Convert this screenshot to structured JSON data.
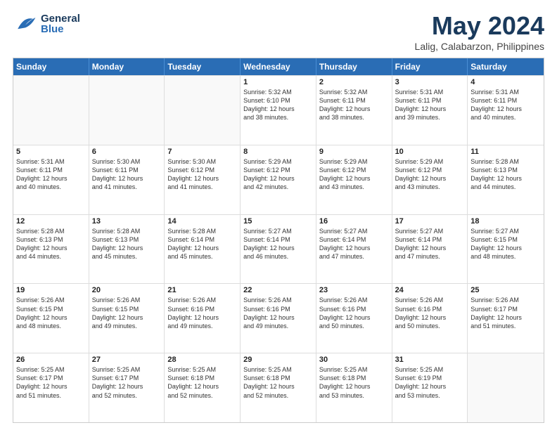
{
  "header": {
    "logo": {
      "general": "General",
      "blue": "Blue"
    },
    "title": "May 2024",
    "subtitle": "Lalig, Calabarzon, Philippines"
  },
  "calendar": {
    "days_of_week": [
      "Sunday",
      "Monday",
      "Tuesday",
      "Wednesday",
      "Thursday",
      "Friday",
      "Saturday"
    ],
    "weeks": [
      [
        {
          "day": "",
          "empty": true
        },
        {
          "day": "",
          "empty": true
        },
        {
          "day": "",
          "empty": true
        },
        {
          "day": "1",
          "lines": [
            "Sunrise: 5:32 AM",
            "Sunset: 6:10 PM",
            "Daylight: 12 hours",
            "and 38 minutes."
          ]
        },
        {
          "day": "2",
          "lines": [
            "Sunrise: 5:32 AM",
            "Sunset: 6:11 PM",
            "Daylight: 12 hours",
            "and 38 minutes."
          ]
        },
        {
          "day": "3",
          "lines": [
            "Sunrise: 5:31 AM",
            "Sunset: 6:11 PM",
            "Daylight: 12 hours",
            "and 39 minutes."
          ]
        },
        {
          "day": "4",
          "lines": [
            "Sunrise: 5:31 AM",
            "Sunset: 6:11 PM",
            "Daylight: 12 hours",
            "and 40 minutes."
          ]
        }
      ],
      [
        {
          "day": "5",
          "lines": [
            "Sunrise: 5:31 AM",
            "Sunset: 6:11 PM",
            "Daylight: 12 hours",
            "and 40 minutes."
          ]
        },
        {
          "day": "6",
          "lines": [
            "Sunrise: 5:30 AM",
            "Sunset: 6:11 PM",
            "Daylight: 12 hours",
            "and 41 minutes."
          ]
        },
        {
          "day": "7",
          "lines": [
            "Sunrise: 5:30 AM",
            "Sunset: 6:12 PM",
            "Daylight: 12 hours",
            "and 41 minutes."
          ]
        },
        {
          "day": "8",
          "lines": [
            "Sunrise: 5:29 AM",
            "Sunset: 6:12 PM",
            "Daylight: 12 hours",
            "and 42 minutes."
          ]
        },
        {
          "day": "9",
          "lines": [
            "Sunrise: 5:29 AM",
            "Sunset: 6:12 PM",
            "Daylight: 12 hours",
            "and 43 minutes."
          ]
        },
        {
          "day": "10",
          "lines": [
            "Sunrise: 5:29 AM",
            "Sunset: 6:12 PM",
            "Daylight: 12 hours",
            "and 43 minutes."
          ]
        },
        {
          "day": "11",
          "lines": [
            "Sunrise: 5:28 AM",
            "Sunset: 6:13 PM",
            "Daylight: 12 hours",
            "and 44 minutes."
          ]
        }
      ],
      [
        {
          "day": "12",
          "lines": [
            "Sunrise: 5:28 AM",
            "Sunset: 6:13 PM",
            "Daylight: 12 hours",
            "and 44 minutes."
          ]
        },
        {
          "day": "13",
          "lines": [
            "Sunrise: 5:28 AM",
            "Sunset: 6:13 PM",
            "Daylight: 12 hours",
            "and 45 minutes."
          ]
        },
        {
          "day": "14",
          "lines": [
            "Sunrise: 5:28 AM",
            "Sunset: 6:14 PM",
            "Daylight: 12 hours",
            "and 45 minutes."
          ]
        },
        {
          "day": "15",
          "lines": [
            "Sunrise: 5:27 AM",
            "Sunset: 6:14 PM",
            "Daylight: 12 hours",
            "and 46 minutes."
          ]
        },
        {
          "day": "16",
          "lines": [
            "Sunrise: 5:27 AM",
            "Sunset: 6:14 PM",
            "Daylight: 12 hours",
            "and 47 minutes."
          ]
        },
        {
          "day": "17",
          "lines": [
            "Sunrise: 5:27 AM",
            "Sunset: 6:14 PM",
            "Daylight: 12 hours",
            "and 47 minutes."
          ]
        },
        {
          "day": "18",
          "lines": [
            "Sunrise: 5:27 AM",
            "Sunset: 6:15 PM",
            "Daylight: 12 hours",
            "and 48 minutes."
          ]
        }
      ],
      [
        {
          "day": "19",
          "lines": [
            "Sunrise: 5:26 AM",
            "Sunset: 6:15 PM",
            "Daylight: 12 hours",
            "and 48 minutes."
          ]
        },
        {
          "day": "20",
          "lines": [
            "Sunrise: 5:26 AM",
            "Sunset: 6:15 PM",
            "Daylight: 12 hours",
            "and 49 minutes."
          ]
        },
        {
          "day": "21",
          "lines": [
            "Sunrise: 5:26 AM",
            "Sunset: 6:16 PM",
            "Daylight: 12 hours",
            "and 49 minutes."
          ]
        },
        {
          "day": "22",
          "lines": [
            "Sunrise: 5:26 AM",
            "Sunset: 6:16 PM",
            "Daylight: 12 hours",
            "and 49 minutes."
          ]
        },
        {
          "day": "23",
          "lines": [
            "Sunrise: 5:26 AM",
            "Sunset: 6:16 PM",
            "Daylight: 12 hours",
            "and 50 minutes."
          ]
        },
        {
          "day": "24",
          "lines": [
            "Sunrise: 5:26 AM",
            "Sunset: 6:16 PM",
            "Daylight: 12 hours",
            "and 50 minutes."
          ]
        },
        {
          "day": "25",
          "lines": [
            "Sunrise: 5:26 AM",
            "Sunset: 6:17 PM",
            "Daylight: 12 hours",
            "and 51 minutes."
          ]
        }
      ],
      [
        {
          "day": "26",
          "lines": [
            "Sunrise: 5:25 AM",
            "Sunset: 6:17 PM",
            "Daylight: 12 hours",
            "and 51 minutes."
          ]
        },
        {
          "day": "27",
          "lines": [
            "Sunrise: 5:25 AM",
            "Sunset: 6:17 PM",
            "Daylight: 12 hours",
            "and 52 minutes."
          ]
        },
        {
          "day": "28",
          "lines": [
            "Sunrise: 5:25 AM",
            "Sunset: 6:18 PM",
            "Daylight: 12 hours",
            "and 52 minutes."
          ]
        },
        {
          "day": "29",
          "lines": [
            "Sunrise: 5:25 AM",
            "Sunset: 6:18 PM",
            "Daylight: 12 hours",
            "and 52 minutes."
          ]
        },
        {
          "day": "30",
          "lines": [
            "Sunrise: 5:25 AM",
            "Sunset: 6:18 PM",
            "Daylight: 12 hours",
            "and 53 minutes."
          ]
        },
        {
          "day": "31",
          "lines": [
            "Sunrise: 5:25 AM",
            "Sunset: 6:19 PM",
            "Daylight: 12 hours",
            "and 53 minutes."
          ]
        },
        {
          "day": "",
          "empty": true
        }
      ]
    ]
  }
}
